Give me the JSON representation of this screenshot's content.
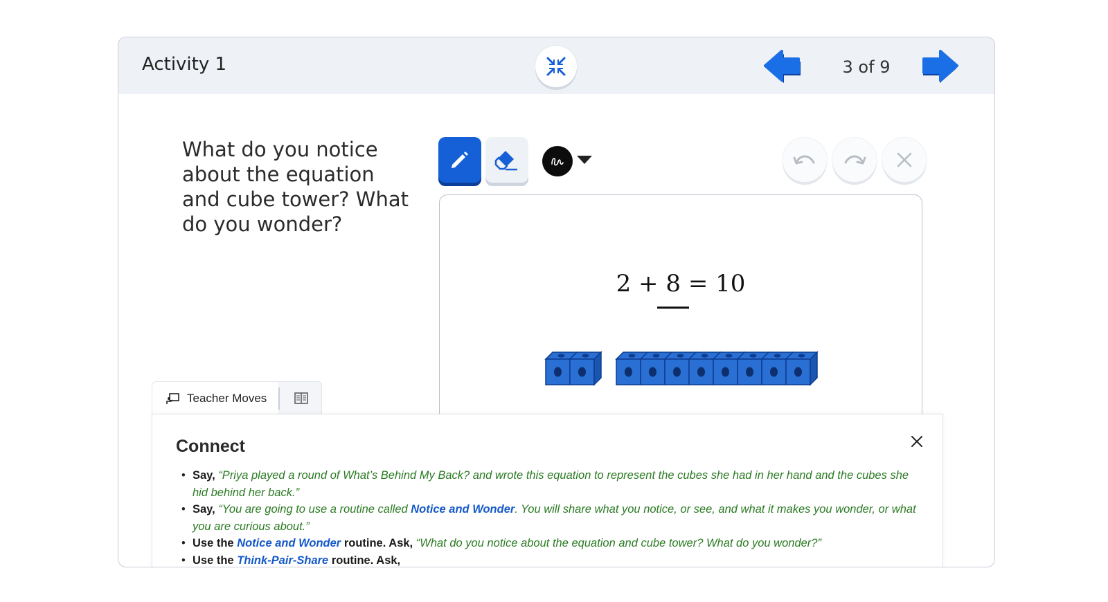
{
  "header": {
    "title": "Activity 1",
    "page_indicator": "3 of 9",
    "collapse_icon": "collapse-arrows-icon",
    "prev_icon": "arrow-left-icon",
    "next_icon": "arrow-right-icon"
  },
  "question": {
    "text": "What do you notice about the equation and cube tower? What do you wonder?"
  },
  "toolbar": {
    "pen_icon": "pencil-icon",
    "eraser_icon": "eraser-icon",
    "color": "#0c0c0c",
    "undo_icon": "undo-icon",
    "redo_icon": "redo-icon",
    "clear_icon": "close-icon"
  },
  "canvas": {
    "equation": {
      "left": "2",
      "plus": "+",
      "blank": "8",
      "equals": "=",
      "result": "10"
    },
    "cube_groups": [
      2,
      8
    ],
    "cube_color": "#2a6fd4"
  },
  "panel": {
    "tabs": {
      "teacher_label": "Teacher Moves",
      "teacher_icon": "presentation-icon",
      "book_icon": "book-icon"
    },
    "title": "Connect",
    "items": [
      {
        "lead": "Say,",
        "quote": "“Priya played a round of What’s Behind My Back? and wrote this equation to represent the cubes she had in her hand and the cubes she hid behind her back.”"
      },
      {
        "lead": "Say,",
        "quote_start": "“You are going to use a routine called ",
        "link": "Notice and Wonder",
        "quote_end": ". You will share what you notice, or see, and what it makes you wonder, or what you are curious about.”"
      },
      {
        "lead_start": "Use the ",
        "link": "Notice and Wonder",
        "lead_end": " routine. Ask,",
        "quote": "“What do you notice about the equation and cube tower? What do you wonder?”"
      },
      {
        "lead_start": "Use the ",
        "link": "Think-Pair-Share",
        "lead_end": " routine. Ask,"
      }
    ]
  }
}
